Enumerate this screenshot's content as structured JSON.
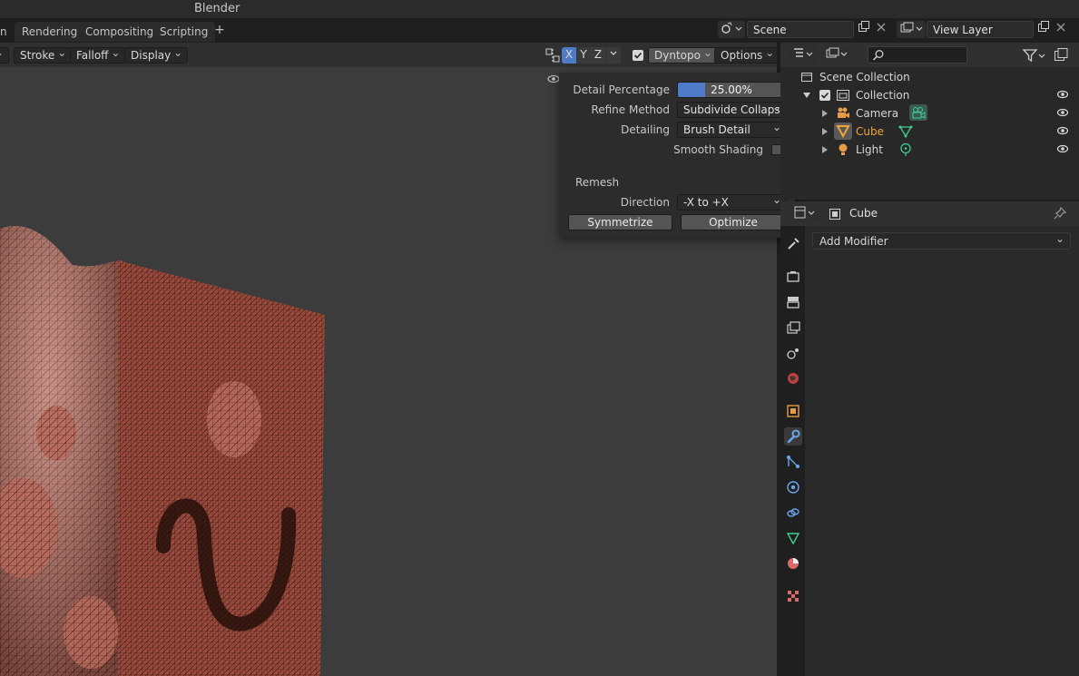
{
  "app": {
    "title": "Blender"
  },
  "workspace_tabs": [
    {
      "label": "n"
    },
    {
      "label": "Rendering"
    },
    {
      "label": "Compositing"
    },
    {
      "label": "Scripting"
    }
  ],
  "workspace_add_label": "+",
  "scene": {
    "value": "Scene"
  },
  "view_layer": {
    "value": "View Layer"
  },
  "viewport_header": {
    "menus": [
      "Stroke",
      "Falloff",
      "Display"
    ],
    "axes": [
      "X",
      "Y",
      "Z"
    ],
    "dyntopo_label": "Dyntopo",
    "options_label": "Options"
  },
  "dyntopo": {
    "detail_percentage_label": "Detail Percentage",
    "detail_percentage_value": "25.00%",
    "detail_percentage_fraction": 0.25,
    "refine_method_label": "Refine Method",
    "refine_method_value": "Subdivide Collapse",
    "detailing_label": "Detailing",
    "detailing_value": "Brush Detail",
    "smooth_shading_label": "Smooth Shading",
    "remesh_heading": "Remesh",
    "direction_label": "Direction",
    "direction_value": "-X to +X",
    "symmetrize_label": "Symmetrize",
    "optimize_label": "Optimize"
  },
  "outliner": {
    "root": "Scene Collection",
    "collection": "Collection",
    "items": [
      {
        "name": "Camera",
        "icon": "camera-icon"
      },
      {
        "name": "Cube",
        "icon": "mesh-icon"
      },
      {
        "name": "Light",
        "icon": "light-icon"
      }
    ]
  },
  "properties": {
    "object_name": "Cube",
    "add_modifier_label": "Add Modifier"
  },
  "colors": {
    "accent_blue": "#4e7ac8",
    "active_object": "#f0a33b",
    "mesh_fill": "#a05040",
    "data_green": "#3fcf8e"
  }
}
